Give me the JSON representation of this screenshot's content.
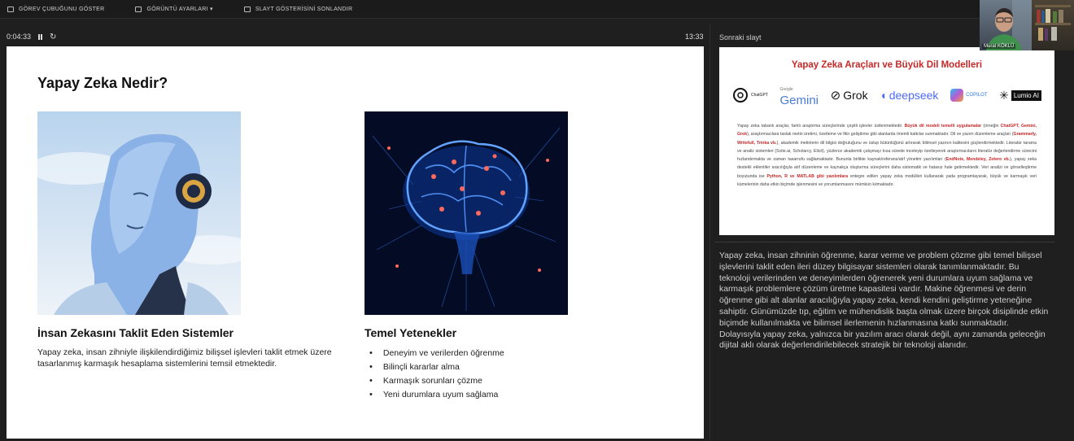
{
  "toolbar": {
    "taskbar": "GÖREV ÇUBUĞUNU GÖSTER",
    "display": "GÖRÜNTÜ AYARLARI ▾",
    "end": "SLAYT GÖSTERİSİNİ SONLANDIR"
  },
  "timer": {
    "elapsed": "0:04:33",
    "clock": "13:33"
  },
  "slide": {
    "title": "Yapay Zeka Nedir?",
    "left_heading": "İnsan Zekasını Taklit Eden Sistemler",
    "left_body": "Yapay zeka, insan zihniyle ilişkilendirdiğimiz bilişsel işlevleri taklit etmek üzere tasarlanmış karmaşık hesaplama sistemlerini temsil etmektedir.",
    "right_heading": "Temel Yetenekler",
    "bullets": [
      "Deneyim ve verilerden öğrenme",
      "Bilinçli kararlar alma",
      "Karmaşık sorunları çözme",
      "Yeni durumlara uyum sağlama"
    ]
  },
  "next_slide": {
    "label": "Sonraki slayt",
    "title": "Yapay Zeka Araçları ve Büyük Dil Modelleri",
    "logos": [
      "ChatGPT",
      "Gemini",
      "Grok",
      "deepseek",
      "COPILOT",
      "Lumio AI"
    ],
    "logo_google": "Google",
    "text_1": "Yapay zeka tabanlı araçlar, farklı araştırma süreçlerinde çeşitli işlevler üstlenmektedir. ",
    "text_2": "Büyük dil modeli temelli uygulamalar",
    "text_3": " (örneğin ",
    "text_4": "ChatGPT, Gemini, Grok",
    "text_5": "), araştırmacılara taslak metin üretimi, özetleme ve fikir geliştirme gibi alanlarda önemli katkılar sunmaktadır. Dil ve yazım düzenleme araçları (",
    "text_6": "Grammarly, Writefull, Trinka vb.",
    "text_7": "), akademik metinlerin dil bilgisi doğruluğunu ve üslup bütünlüğünü artırarak bilimsel yazının kalitesini güçlendirmektedir. Literatür tarama ve analiz sistemleri (Scite.ai, Scholarcy, Elicit), yüzlerce akademik çalışmayı kısa sürede inceleyip özetleyerek araştırmacıların literatür değerlendirme sürecini hızlandırmakta ve zaman tasarrufu sağlamaktadır. Bununla birlikte kaynak/referans/atıf yönetim yazılımları (",
    "text_8": "EndNote, Mendeley, Zotero vb.",
    "text_9": "), yapay zeka destekli eklentiler aracılığıyla atıf düzenleme ve kaynakça oluşturma süreçlerini daha sistematik ve hatasız hale getirmektedir. Veri analizi ve görselleştirme boyutunda ise ",
    "text_10": "Python, R ve MATLAB gibi yazılımlara",
    "text_11": " entegre edilen yapay zeka modülleri kullanarak yada programlayarak, büyük ve karmaşık veri kümelerinin daha etkin biçimde işlenmesini ve yorumlanmasını mümkün kılmaktadır."
  },
  "notes": "Yapay zeka, insan zihninin öğrenme, karar verme ve problem çözme gibi temel bilişsel işlevlerini taklit eden ileri düzey bilgisayar sistemleri olarak tanımlanmaktadır. Bu teknoloji verilerinden ve deneyimlerden öğrenerek yeni durumlara uyum sağlama ve karmaşık problemlere çözüm üretme kapasitesi vardır. Makine öğrenmesi ve derin öğrenme gibi alt alanlar aracılığıyla yapay zeka, kendi kendini geliştirme yeteneğine sahiptir. Günümüzde tıp, eğitim ve mühendislik başta olmak üzere birçok disiplinde etkin biçimde kullanılmakta ve bilimsel ilerlemenin hızlanmasına katkı sunmaktadır. Dolayısıyla yapay zeka, yalnızca bir yazılım aracı olarak değil, aynı zamanda geleceğin dijital aklı olarak değerlendirilebilecek stratejik bir teknoloji alanıdır.",
  "camera": {
    "name": "Murat KÖKLÜ"
  }
}
